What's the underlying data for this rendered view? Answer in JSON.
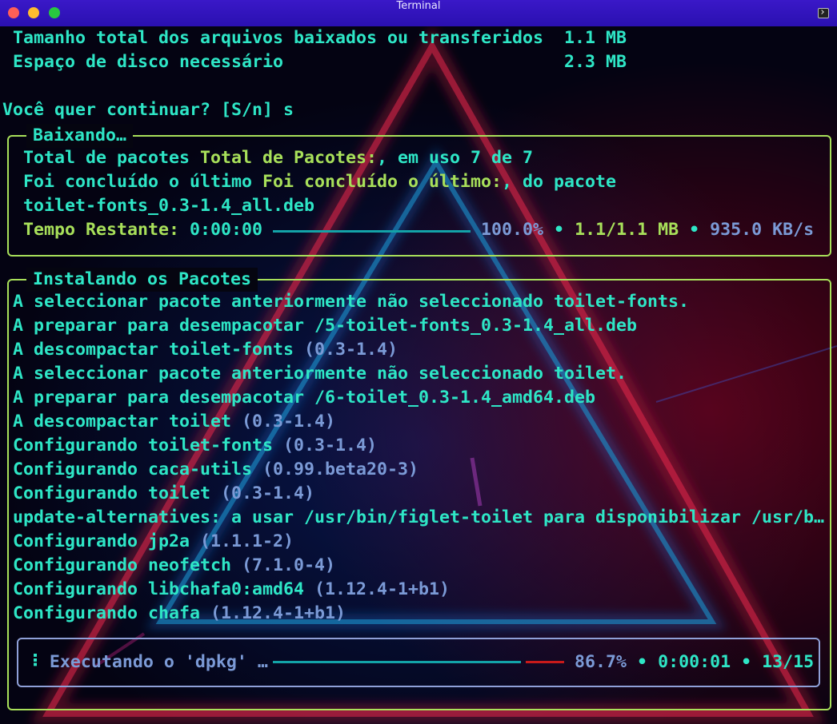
{
  "window": {
    "title": "Terminal"
  },
  "colors": {
    "teal": "#2ee6c6",
    "green": "#a8e05a",
    "muted": "#7b9ad6",
    "progress": "#13a3a8",
    "remaining": "#c81a1a"
  },
  "summary": [
    "Tamanho total dos arquivos baixados ou transferidos  1.1 MB",
    "Espaço de disco necessário                           2.3 MB"
  ],
  "prompt": "Você quer continuar? [S/n] s",
  "download": {
    "title": "Baixando…",
    "packages_a": "Total de pacotes ",
    "packages_b": "Total de Pacotes:",
    "packages_c": ", em uso 7 de 7",
    "last_a": "Foi concluído o último ",
    "last_b": "Foi concluído o último:",
    "last_c": ", do pacote",
    "file": "toilet-fonts_0.3-1.4_all.deb",
    "remaining_label": "Tempo Restante:",
    "remaining_value": "0:00:00",
    "progress": 1.0,
    "percent": "100.0%",
    "sep": "•",
    "size": "1.1/1.1 MB",
    "speed": "935.0 KB/s"
  },
  "install": {
    "title": "Instalando os Pacotes",
    "lines": [
      {
        "text": "A seleccionar pacote anteriormente não seleccionado toilet-fonts.",
        "version": ""
      },
      {
        "text": "A preparar para desempacotar /5-toilet-fonts_0.3-1.4_all.deb",
        "version": ""
      },
      {
        "text": "A descompactar toilet-fonts ",
        "version": "(0.3-1.4)"
      },
      {
        "text": "A seleccionar pacote anteriormente não seleccionado toilet.",
        "version": ""
      },
      {
        "text": "A preparar para desempacotar /6-toilet_0.3-1.4_amd64.deb",
        "version": ""
      },
      {
        "text": "A descompactar toilet ",
        "version": "(0.3-1.4)"
      },
      {
        "text": "Configurando toilet-fonts ",
        "version": "(0.3-1.4)"
      },
      {
        "text": "Configurando caca-utils ",
        "version": "(0.99.beta20-3)"
      },
      {
        "text": "Configurando toilet ",
        "version": "(0.3-1.4)"
      },
      {
        "text": "update-alternatives: a usar /usr/bin/figlet-toilet para disponibilizar /usr/b…",
        "version": ""
      },
      {
        "text": "Configurando jp2a ",
        "version": "(1.1.1-2)"
      },
      {
        "text": "Configurando neofetch ",
        "version": "(7.1.0-4)"
      },
      {
        "text": "Configurando libchafa0:amd64 ",
        "version": "(1.12.4-1+b1)"
      },
      {
        "text": "Configurando chafa ",
        "version": "(1.12.4-1+b1)"
      }
    ],
    "exec": {
      "spinner": "⠸",
      "label": "Executando o 'dpkg' …",
      "progress": 0.867,
      "percent": "86.7%",
      "elapsed": "0:00:01",
      "count": "13/15",
      "sep": "•"
    }
  }
}
